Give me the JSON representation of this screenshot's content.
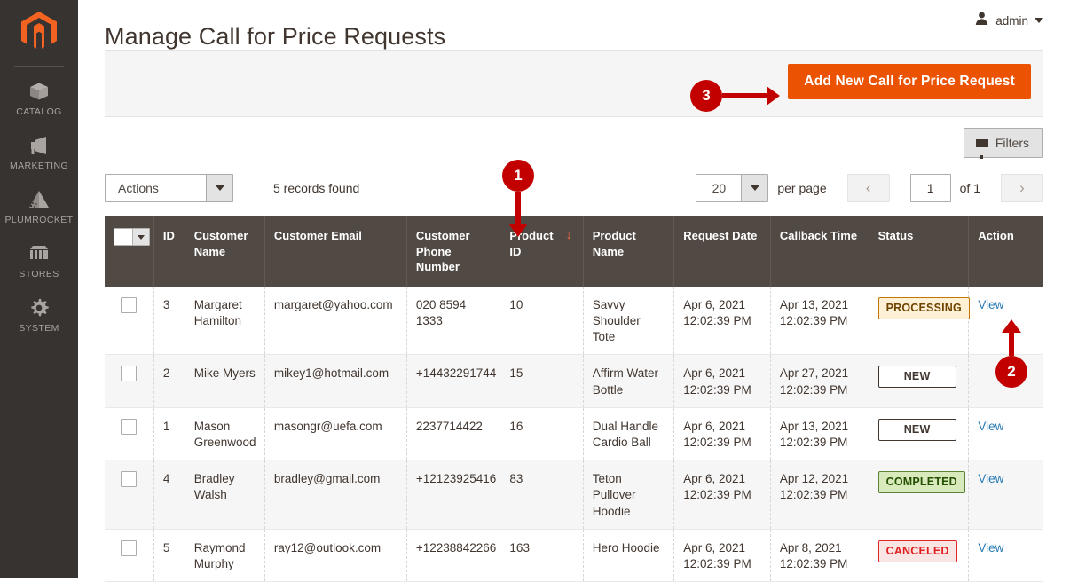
{
  "sidebar": {
    "logo_name": "magento-logo-icon",
    "items": [
      {
        "label": "CATALOG",
        "icon": "box-icon"
      },
      {
        "label": "MARKETING",
        "icon": "megaphone-icon"
      },
      {
        "label": "PLUMROCKET",
        "icon": "pyramid-icon"
      },
      {
        "label": "STORES",
        "icon": "storefront-icon"
      },
      {
        "label": "SYSTEM",
        "icon": "gear-icon"
      }
    ]
  },
  "header": {
    "title": "Manage Call for Price Requests",
    "admin_label": "admin",
    "admin_icon": "user-avatar-icon",
    "caret_icon": "chevron-down-icon"
  },
  "actionbar": {
    "add_button_label": "Add New Call for Price Request",
    "add_button_color": "#eb5202"
  },
  "filters": {
    "button_label": "Filters",
    "icon": "funnel-icon"
  },
  "toolbar": {
    "actions_label": "Actions",
    "actions_caret_icon": "chevron-down-icon",
    "records_found": "5 records found",
    "per_page_value": "20",
    "per_page_caret_icon": "chevron-down-icon",
    "per_page_label": "per page",
    "prev_icon": "chevron-left-icon",
    "next_icon": "chevron-right-icon",
    "page_value": "1",
    "of_label": "of 1"
  },
  "grid": {
    "mass_select_icon": "checkbox-dropdown-icon",
    "sort_arrow_icon": "sort-desc-arrow-icon",
    "sort_arrow_glyph": "↓",
    "sorted_column": "Product ID",
    "columns": [
      "ID",
      "Customer Name",
      "Customer Email",
      "Customer Phone Number",
      "Product ID",
      "Product Name",
      "Request Date",
      "Callback Time",
      "Status",
      "Action"
    ],
    "action_link_label": "View",
    "rows": [
      {
        "id": "3",
        "customer_name": "Margaret Hamilton",
        "customer_email": "margaret@yahoo.com",
        "customer_phone": "020 8594 1333",
        "product_id": "10",
        "product_name": "Savvy Shoulder Tote",
        "request_date": "Apr 6, 2021 12:02:39 PM",
        "callback_time": "Apr 13, 2021 12:02:39 PM",
        "status": "PROCESSING",
        "status_class": "badge-processing",
        "action": "View"
      },
      {
        "id": "2",
        "customer_name": "Mike Myers",
        "customer_email": "mikey1@hotmail.com",
        "customer_phone": "+14432291744",
        "product_id": "15",
        "product_name": "Affirm Water Bottle",
        "request_date": "Apr 6, 2021 12:02:39 PM",
        "callback_time": "Apr 27, 2021 12:02:39 PM",
        "status": "NEW",
        "status_class": "badge-new",
        "action": ""
      },
      {
        "id": "1",
        "customer_name": "Mason Greenwood",
        "customer_email": "masongr@uefa.com",
        "customer_phone": "2237714422",
        "product_id": "16",
        "product_name": "Dual Handle Cardio Ball",
        "request_date": "Apr 6, 2021 12:02:39 PM",
        "callback_time": "Apr 13, 2021 12:02:39 PM",
        "status": "NEW",
        "status_class": "badge-new",
        "action": "View"
      },
      {
        "id": "4",
        "customer_name": "Bradley Walsh",
        "customer_email": "bradley@gmail.com",
        "customer_phone": "+12123925416",
        "product_id": "83",
        "product_name": "Teton Pullover Hoodie",
        "request_date": "Apr 6, 2021 12:02:39 PM",
        "callback_time": "Apr 12, 2021 12:02:39 PM",
        "status": "COMPLETED",
        "status_class": "badge-completed",
        "action": "View"
      },
      {
        "id": "5",
        "customer_name": "Raymond Murphy",
        "customer_email": "ray12@outlook.com",
        "customer_phone": "+12238842266",
        "product_id": "163",
        "product_name": "Hero Hoodie",
        "request_date": "Apr 6, 2021 12:02:39 PM",
        "callback_time": "Apr 8, 2021 12:02:39 PM",
        "status": "CANCELED",
        "status_class": "badge-canceled",
        "action": "View"
      }
    ]
  },
  "annotations": {
    "color": "#c30000",
    "markers": [
      {
        "number": "1",
        "direction": "down"
      },
      {
        "number": "2",
        "direction": "up"
      },
      {
        "number": "3",
        "direction": "right"
      }
    ]
  }
}
